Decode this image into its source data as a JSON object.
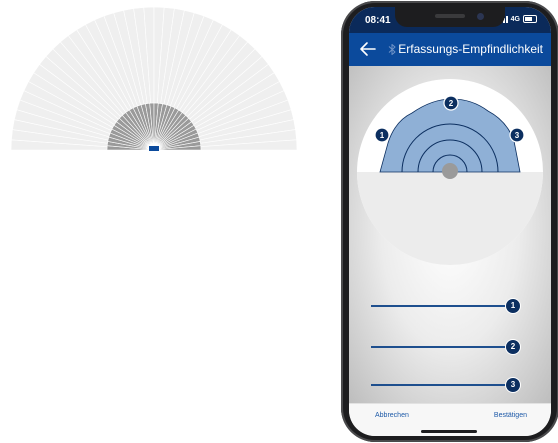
{
  "fan_preview": {
    "outer_rays": 44,
    "inner_rays": 34,
    "outer_color": "#efefef",
    "inner_color": "#9a9a9a",
    "marker_color": "#0b4a9c"
  },
  "status_bar": {
    "time": "08:41",
    "network": "4G"
  },
  "app_bar": {
    "title": "Erfassungs-Empfindlichkeit",
    "back_icon": "arrow-left-icon",
    "status_icon": "bluetooth-icon"
  },
  "sensitivity": {
    "zones": [
      {
        "label": "1"
      },
      {
        "label": "2"
      },
      {
        "label": "3"
      }
    ],
    "sliders": [
      {
        "label": "1",
        "value": 100
      },
      {
        "label": "2",
        "value": 100
      },
      {
        "label": "3",
        "value": 100
      }
    ],
    "zone_color": "#8fb0d6",
    "accent_color": "#0c2f60"
  },
  "footer": {
    "cancel_label": "Abbrechen",
    "confirm_label": "Bestätigen"
  }
}
